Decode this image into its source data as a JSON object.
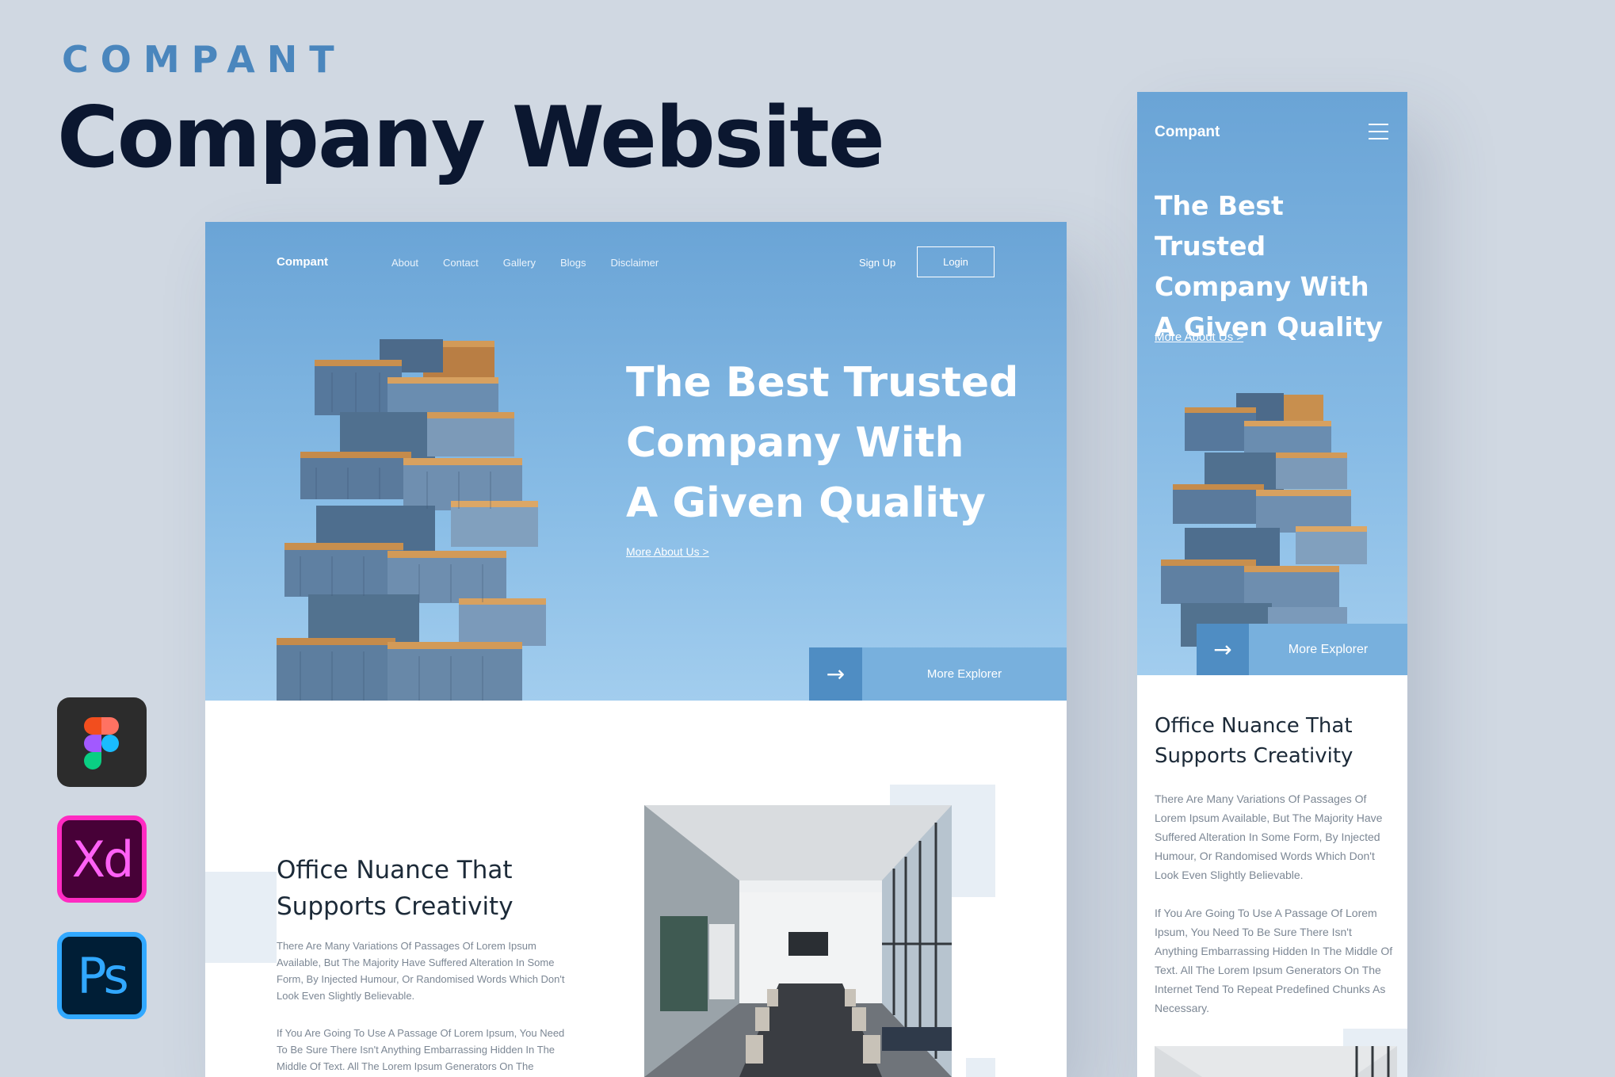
{
  "header": {
    "kicker": "COMPANT",
    "title": "Company Website"
  },
  "tools": [
    {
      "name": "figma-icon",
      "label": ""
    },
    {
      "name": "xd-icon",
      "label": "Xd"
    },
    {
      "name": "ps-icon",
      "label": "Ps"
    }
  ],
  "desktop": {
    "nav": {
      "logo": "Compant",
      "links": [
        "About",
        "Contact",
        "Gallery",
        "Blogs",
        "Disclaimer"
      ],
      "signup": "Sign Up",
      "login": "Login"
    },
    "hero": {
      "title_lines": [
        "The Best Trusted",
        "Company With",
        "A Given Quality"
      ],
      "link": "More About Us >",
      "cta": "More Explorer"
    },
    "section": {
      "title_lines": [
        "Office Nuance That",
        "Supports Creativity"
      ],
      "p1": "There Are Many Variations Of Passages Of Lorem Ipsum Available, But The Majority Have Suffered Alteration In Some Form, By Injected Humour, Or Randomised Words Which Don't Look Even Slightly Believable.",
      "p2": "If You Are Going To Use A Passage Of Lorem Ipsum, You Need To Be Sure There Isn't Anything Embarrassing Hidden In The Middle Of Text. All The Lorem Ipsum Generators On The"
    }
  },
  "mobile": {
    "logo": "Compant",
    "hero": {
      "title_lines": [
        "The Best Trusted",
        "Company With",
        "A Given Quality"
      ],
      "link": "More About Us >",
      "cta": "More Explorer"
    },
    "section": {
      "title_lines": [
        "Office Nuance That",
        "Supports Creativity"
      ],
      "p1": "There Are Many Variations Of Passages Of Lorem Ipsum Available, But The Majority Have Suffered Alteration In Some Form, By Injected Humour, Or Randomised Words Which Don't Look Even Slightly Believable.",
      "p2": "If You Are Going To Use A Passage Of Lorem Ipsum, You Need To Be Sure There Isn't Anything Embarrassing Hidden In The Middle Of Text. All The Lorem Ipsum Generators On The Internet Tend To Repeat Predefined Chunks As Necessary."
    }
  },
  "colors": {
    "background": "#d0d8e2",
    "accent": "#4a86bd",
    "hero_sky": "#6aa4d6",
    "cta_dark": "#4f8dc3",
    "cta_light": "#78b0dd",
    "title_dark": "#0b1730"
  }
}
